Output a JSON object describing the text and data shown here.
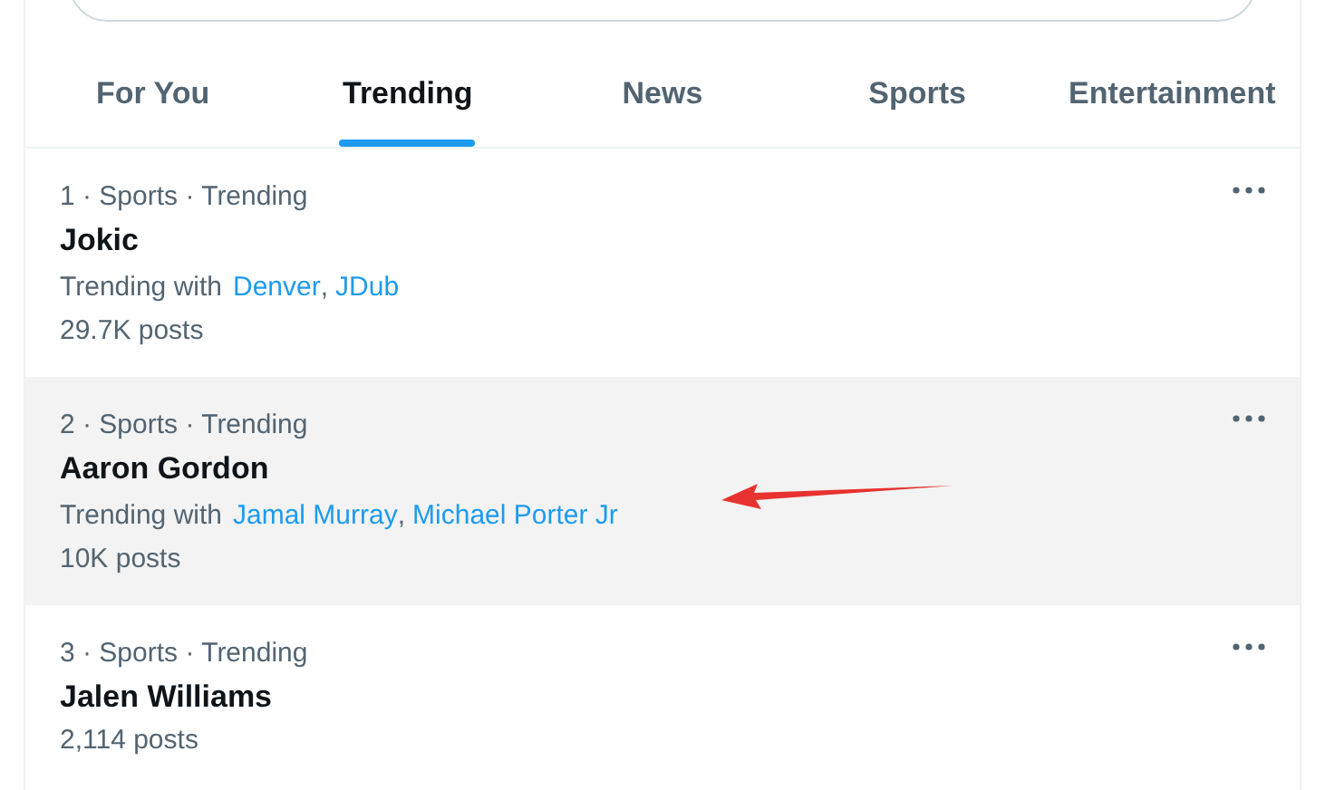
{
  "tabs": [
    {
      "label": "For You",
      "selected": false
    },
    {
      "label": "Trending",
      "selected": true
    },
    {
      "label": "News",
      "selected": false
    },
    {
      "label": "Sports",
      "selected": false
    },
    {
      "label": "Entertainment",
      "selected": false
    }
  ],
  "trends": [
    {
      "context": "1 · Sports · Trending",
      "title": "Jokic",
      "with_label": "Trending with",
      "with": [
        "Denver",
        "JDub"
      ],
      "posts": "29.7K posts",
      "highlighted": false
    },
    {
      "context": "2 · Sports · Trending",
      "title": "Aaron Gordon",
      "with_label": "Trending with",
      "with": [
        "Jamal Murray",
        "Michael Porter Jr"
      ],
      "posts": "10K posts",
      "highlighted": true
    },
    {
      "context": "3 · Sports · Trending",
      "title": "Jalen Williams",
      "posts": "2,114 posts",
      "highlighted": false
    }
  ],
  "link_separator": ",",
  "annotation": {
    "kind": "arrow"
  }
}
